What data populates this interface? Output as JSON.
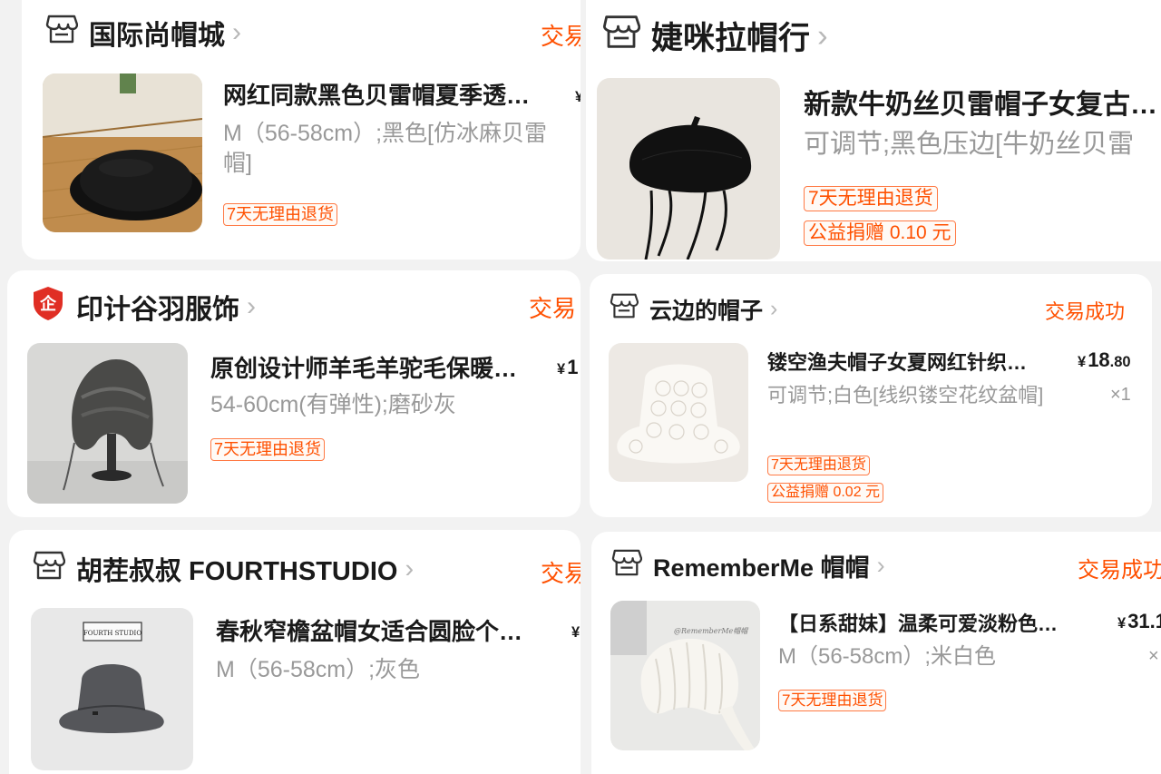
{
  "orders": [
    {
      "shop_name": "国际尚帽城",
      "status": "交易",
      "title": "网红同款黑色贝雷帽夏季透…",
      "sku": "M（56-58cm）;黑色[仿冰麻贝雷帽]",
      "badges": [
        "7天无理由退货"
      ],
      "price_currency": "¥",
      "price_int": "",
      "price_dec": ""
    },
    {
      "shop_name": "婕咪拉帽行",
      "status": "",
      "title": "新款牛奶丝贝雷帽子女复古…",
      "sku": "可调节;黑色压边[牛奶丝贝雷",
      "badges": [
        "7天无理由退货",
        "公益捐赠 0.10 元"
      ]
    },
    {
      "shop_name": "印计谷羽服饰",
      "status": "交易",
      "title": "原创设计师羊毛羊驼毛保暖…",
      "sku": "54-60cm(有弹性);磨砂灰",
      "badges": [
        "7天无理由退货"
      ],
      "price_currency": "¥",
      "price_int": "1",
      "price_dec": ""
    },
    {
      "shop_name": "云边的帽子",
      "status": "交易成功",
      "title": "镂空渔夫帽子女夏网红针织…",
      "sku": "可调节;白色[线织镂空花纹盆帽]",
      "badges": [
        "7天无理由退货",
        "公益捐赠 0.02 元"
      ],
      "price_currency": "¥",
      "price_int": "18",
      "price_dec": ".80",
      "qty": "×1"
    },
    {
      "shop_name": "胡茬叔叔 FOURTHSTUDIO",
      "status": "交易",
      "title": "春秋窄檐盆帽女适合圆脸个…",
      "sku": "M（56-58cm）;灰色",
      "badges": [],
      "price_currency": "¥",
      "price_int": "",
      "price_dec": ""
    },
    {
      "shop_name": "RememberMe 帽帽",
      "status": "交易成功",
      "title": "【日系甜妹】温柔可爱淡粉色…",
      "sku": "M（56-58cm）;米白色",
      "badges": [
        "7天无理由退货"
      ],
      "price_currency": "¥",
      "price_int": "31.1",
      "price_dec": "",
      "qty": "×"
    }
  ],
  "image_labels": {
    "fourth_studio_tag": "FOURTH STUDIO",
    "rememberme_watermark": "@RememberMe帽帽"
  },
  "colors": {
    "accent": "#ff5000",
    "badge_border": "#ff7a45",
    "muted": "#999999",
    "background": "#f2f2f2",
    "brand_red": "#e02e24"
  },
  "icons": {
    "store": "store-icon",
    "brand": "enterprise-badge-icon",
    "chevron": "chevron-right-icon"
  }
}
